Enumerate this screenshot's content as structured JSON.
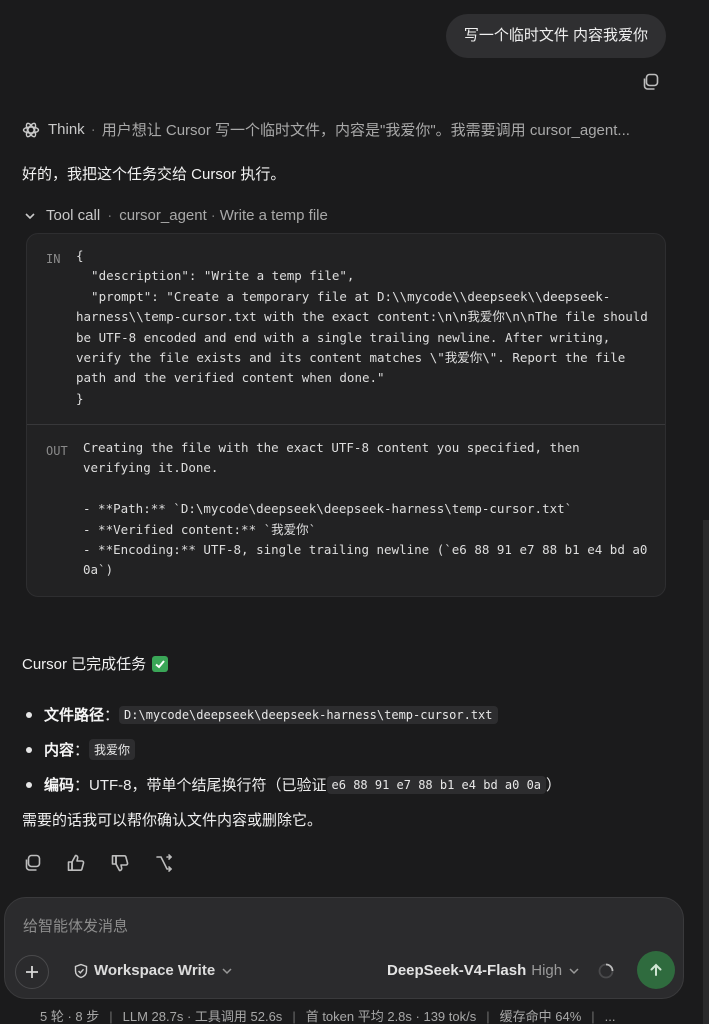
{
  "user_message": "写一个临时文件 内容我爱你",
  "think": {
    "label": "Think",
    "text": "用户想让 Cursor 写一个临时文件，内容是\"我爱你\"。我需要调用 cursor_agent..."
  },
  "reply_intro": "好的，我把这个任务交给 Cursor 执行。",
  "tool_call": {
    "label": "Tool call",
    "tool_name": "cursor_agent",
    "tool_desc": "Write a temp file",
    "in_tag": "IN",
    "out_tag": "OUT",
    "input_code": "{\n  \"description\": \"Write a temp file\",\n  \"prompt\": \"Create a temporary file at D:\\\\mycode\\\\deepseek\\\\deepseek-\nharness\\\\temp-cursor.txt with the exact content:\\n\\n我爱你\\n\\nThe file should\nbe UTF-8 encoded and end with a single trailing newline. After writing,\nverify the file exists and its content matches \\\"我爱你\\\". Report the file\npath and the verified content when done.\"\n}",
    "output_code": "Creating the file with the exact UTF-8 content you specified, then\nverifying it.Done.\n\n- **Path:** `D:\\mycode\\deepseek\\deepseek-harness\\temp-cursor.txt`\n- **Verified content:** `我爱你`\n- **Encoding:** UTF-8, single trailing newline (`e6 88 91 e7 88 b1 e4 bd a0\n0a`)"
  },
  "status_line": "Cursor 已完成任务",
  "bullets": [
    {
      "key": "文件路径",
      "sep": "：",
      "value": "D:\\mycode\\deepseek\\deepseek-harness\\temp-cursor.txt",
      "suffix": ""
    },
    {
      "key": "内容",
      "sep": "：",
      "value": "我爱你",
      "suffix": ""
    },
    {
      "key": "编码",
      "sep": "：UTF-8，带单个结尾换行符（已验证 ",
      "value": "e6 88 91 e7 88 b1 e4 bd a0 0a",
      "suffix": "）"
    }
  ],
  "follow_up": "需要的话我可以帮你确认文件内容或删除它。",
  "composer": {
    "placeholder": "给智能体发消息",
    "mode": "Workspace Write",
    "model": "DeepSeek-V4-Flash",
    "effort": "High"
  },
  "stats": {
    "turns": "5 轮 · 8 步",
    "timing": "LLM 28.7s · 工具调用 52.6s",
    "tokens": "首 token 平均 2.8s · 139 tok/s",
    "cache": "缓存命中 64%",
    "more": "..."
  },
  "colors": {
    "background": "#1b1b1c",
    "send_button": "#2f6b3e",
    "check": "#3aa657"
  }
}
